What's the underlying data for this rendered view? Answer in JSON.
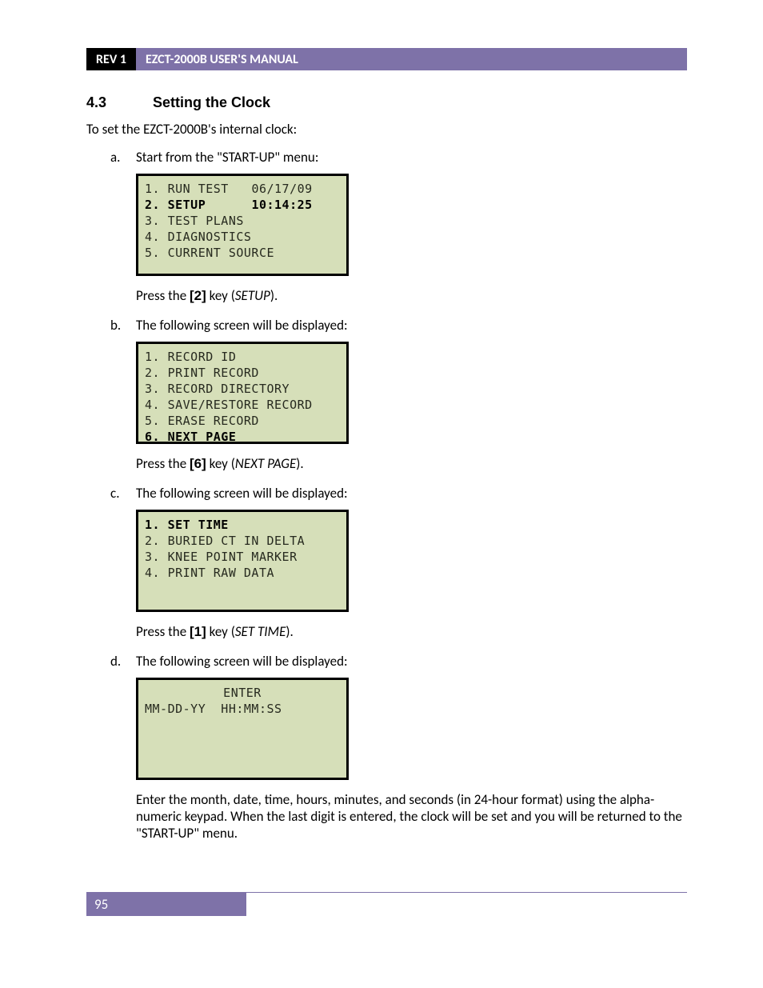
{
  "header": {
    "rev": "REV 1",
    "title": "EZCT-2000B USER'S MANUAL"
  },
  "section": {
    "number": "4.3",
    "title": "Setting the Clock"
  },
  "intro": "To set the EZCT-2000B's internal clock:",
  "steps": {
    "a": {
      "marker": "a.",
      "text": "Start from the \"START-UP\" menu:",
      "lcd": {
        "line1_left": "1. RUN TEST",
        "line1_right": "06/17/09",
        "line2_left": "2. SETUP",
        "line2_right": "10:14:25",
        "line3": "3. TEST PLANS",
        "line4": "4. DIAGNOSTICS",
        "line5": "5. CURRENT SOURCE"
      },
      "press_pre": "Press the ",
      "press_key": "[2]",
      "press_mid": " key (",
      "press_name": "SETUP",
      "press_post": ")."
    },
    "b": {
      "marker": "b.",
      "text": "The following screen will be displayed:",
      "lcd": {
        "line1": "1. RECORD ID",
        "line2": "2. PRINT RECORD",
        "line3": "3. RECORD DIRECTORY",
        "line4": "4. SAVE/RESTORE RECORD",
        "line5": "5. ERASE RECORD",
        "line6": "6. NEXT PAGE"
      },
      "press_pre": "Press the ",
      "press_key": "[6]",
      "press_mid": " key (",
      "press_name": "NEXT PAGE",
      "press_post": ")."
    },
    "c": {
      "marker": "c.",
      "text": "The following screen will be displayed:",
      "lcd": {
        "line1": "1. SET TIME",
        "line2": "2. BURIED CT IN DELTA",
        "line3": "3. KNEE POINT MARKER",
        "line4": "4. PRINT RAW DATA"
      },
      "press_pre": "Press the ",
      "press_key": "[1]",
      "press_mid": " key (",
      "press_name": "SET TIME",
      "press_post": ")."
    },
    "d": {
      "marker": "d.",
      "text": "The following screen will be displayed:",
      "lcd": {
        "line1": "ENTER",
        "line2": "MM-DD-YY  HH:MM:SS"
      },
      "final": "Enter the month, date, time, hours, minutes, and seconds (in 24-hour format) using the alpha-numeric keypad. When the last digit is entered, the clock will be set and you will be returned to the \"START-UP\" menu."
    }
  },
  "footer": {
    "page": "95"
  }
}
